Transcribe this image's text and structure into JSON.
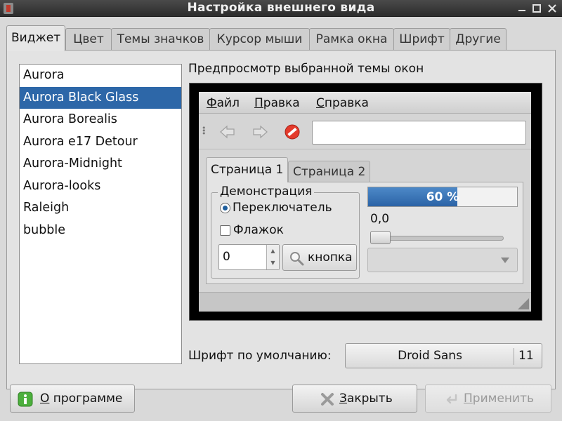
{
  "window": {
    "title": "Настройка внешнего вида"
  },
  "tabs": [
    {
      "label": "Виджет",
      "active": true
    },
    {
      "label": "Цвет",
      "active": false
    },
    {
      "label": "Темы значков",
      "active": false
    },
    {
      "label": "Курсор мыши",
      "active": false
    },
    {
      "label": "Рамка окна",
      "active": false
    },
    {
      "label": "Шрифт",
      "active": false
    },
    {
      "label": "Другие",
      "active": false
    }
  ],
  "theme_list": {
    "items": [
      "Aurora",
      "Aurora Black Glass",
      "Aurora Borealis",
      "Aurora e17 Detour",
      "Aurora-Midnight",
      "Aurora-looks",
      "Raleigh",
      "bubble"
    ],
    "selected": "Aurora Black Glass"
  },
  "preview": {
    "heading": "Предпросмотр выбранной темы окон",
    "menu": {
      "file": {
        "mnemonic": "Ф",
        "rest": "айл"
      },
      "edit": {
        "mnemonic": "П",
        "rest": "равка"
      },
      "help": {
        "mnemonic": "С",
        "rest": "правка"
      }
    },
    "toolbar_icons": [
      "back-icon",
      "forward-icon",
      "stop-icon"
    ],
    "entry_value": "",
    "tabs": [
      "Страница 1",
      "Страница 2"
    ],
    "frame_label": "Демонстрация",
    "radio_label": "Переключатель",
    "radio_checked": true,
    "check_label": "Флажок",
    "check_checked": false,
    "spin_value": "0",
    "button_label": "кнопка",
    "progress": {
      "fraction": 0.6,
      "text": "60 %"
    },
    "scale": {
      "value_text": "0,0",
      "fraction": 0.0
    },
    "combo_value": ""
  },
  "font": {
    "label": "Шрифт по умолчанию:",
    "name": "Droid Sans",
    "size": "11"
  },
  "buttons": {
    "about": {
      "mnemonic": "О",
      "rest": " программе"
    },
    "close": {
      "mnemonic": "З",
      "rest": "акрыть"
    },
    "apply": {
      "mnemonic": "П",
      "rest": "рименить",
      "enabled": false
    }
  },
  "colors": {
    "selection": "#2d67a8",
    "progress": "#3a74b8",
    "titlebar": "#333333"
  }
}
